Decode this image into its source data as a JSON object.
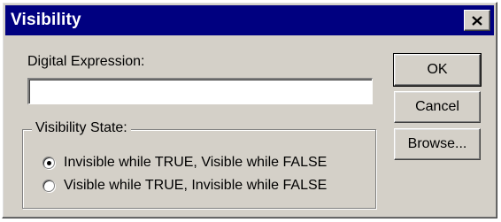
{
  "window": {
    "title": "Visibility",
    "close_icon": "close-icon"
  },
  "expression": {
    "label": "Digital Expression:",
    "value": ""
  },
  "visibility_state": {
    "group_label": "Visibility State:",
    "options": [
      {
        "label": "Invisible while TRUE, Visible while FALSE",
        "selected": true
      },
      {
        "label": "Visible while TRUE, Invisible while FALSE",
        "selected": false
      }
    ]
  },
  "buttons": {
    "ok": "OK",
    "cancel": "Cancel",
    "browse": "Browse..."
  },
  "colors": {
    "titlebar": "#000080",
    "face": "#d4d0c8"
  }
}
